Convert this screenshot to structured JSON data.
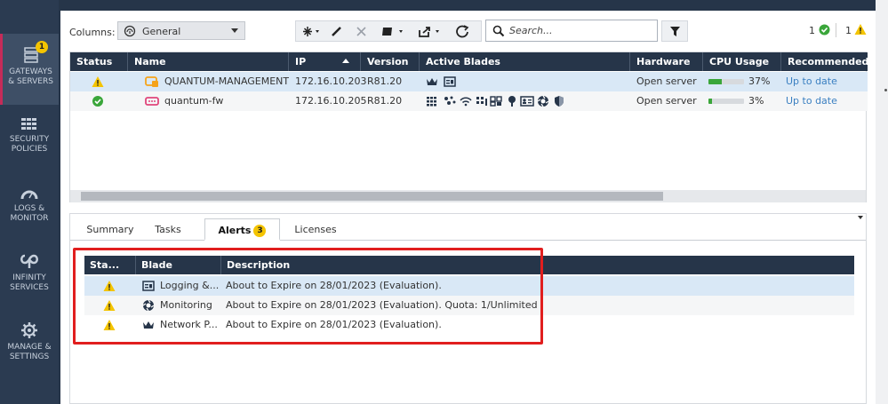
{
  "sidebar": {
    "items": [
      {
        "label_line1": "GATEWAYS",
        "label_line2": "& SERVERS",
        "badge": "1",
        "icon": "gateways-icon"
      },
      {
        "label_line1": "SECURITY",
        "label_line2": "POLICIES",
        "icon": "policies-icon"
      },
      {
        "label_line1": "LOGS &",
        "label_line2": "MONITOR",
        "icon": "logs-gauge-icon"
      },
      {
        "label_line1": "INFINITY",
        "label_line2": "SERVICES",
        "icon": "infinity-icon"
      },
      {
        "label_line1": "MANAGE &",
        "label_line2": "SETTINGS",
        "icon": "gear-icon"
      }
    ]
  },
  "toolbar": {
    "columns_label": "Columns:",
    "columns_value": "General",
    "search_placeholder": "Search...",
    "ok_count": "1",
    "warn_count": "1"
  },
  "gateways": {
    "columns": [
      "Status",
      "Name",
      "IP",
      "Version",
      "Active Blades",
      "Hardware",
      "CPU Usage",
      "Recommended U"
    ],
    "rows": [
      {
        "status": "warning",
        "name": "QUANTUM-MANAGEMENT",
        "ip": "172.16.10.203",
        "version": "R81.20",
        "hardware": "Open server",
        "cpu": "37%",
        "cpu_fraction": 0.37,
        "recommended": "Up to date"
      },
      {
        "status": "ok",
        "name": "quantum-fw",
        "ip": "172.16.10.205",
        "version": "R81.20",
        "hardware": "Open server",
        "cpu": "3%",
        "cpu_fraction": 0.03,
        "recommended": "Up to date"
      }
    ]
  },
  "tabs": [
    {
      "label": "Summary"
    },
    {
      "label": "Tasks"
    },
    {
      "label": "Alerts",
      "badge": "3"
    },
    {
      "label": "Licenses"
    }
  ],
  "alerts": {
    "columns": [
      "Sta...",
      "Blade",
      "Description"
    ],
    "rows": [
      {
        "status": "warning",
        "blade": "Logging &...",
        "blade_icon": "logging-icon",
        "description": "About to Expire on 28/01/2023 (Evaluation)."
      },
      {
        "status": "warning",
        "blade": "Monitoring",
        "blade_icon": "monitoring-icon",
        "description": "About to Expire on 28/01/2023 (Evaluation). Quota: 1/Unlimited"
      },
      {
        "status": "warning",
        "blade": "Network P...",
        "blade_icon": "crown-icon",
        "description": "About to Expire on 28/01/2023 (Evaluation)."
      }
    ]
  },
  "colors": {
    "nav_bg": "#2b3b51",
    "header_bg": "#263549",
    "selected_row": "#d9e8f6",
    "warning": "#f4c400",
    "ok": "#3aa63a",
    "highlight": "#e11e1e",
    "link": "#3a7fc1"
  }
}
